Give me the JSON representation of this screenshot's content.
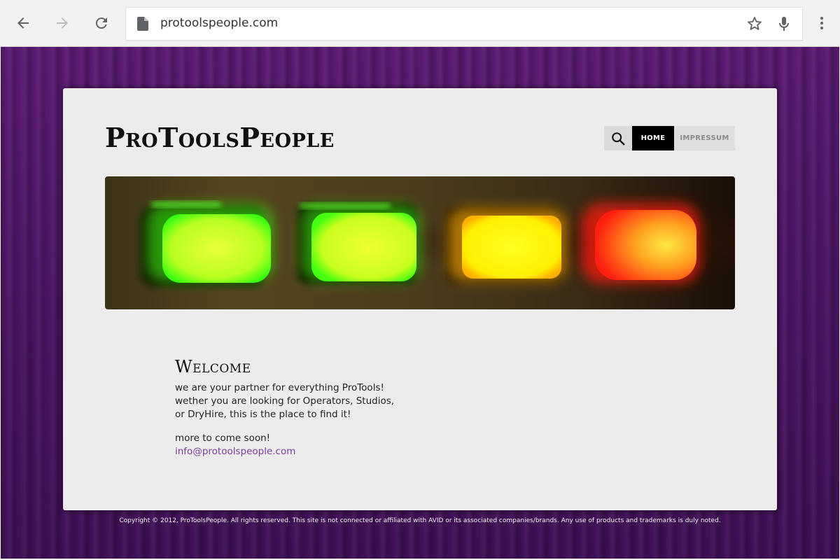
{
  "browser": {
    "url": "protoolspeople.com",
    "icons": [
      "back-arrow-icon",
      "forward-arrow-icon",
      "reload-icon",
      "page-icon",
      "star-icon",
      "mic-icon",
      "more-vert-icon"
    ]
  },
  "site": {
    "title": "ProToolsPeople",
    "nav": {
      "home": "HOME",
      "impressum": "IMPRESSUM"
    },
    "colors": {
      "background": "#4d1566",
      "card": "#ececec",
      "link": "#7d3b9a",
      "nav_active": "#000000"
    }
  },
  "content": {
    "heading": "Welcome",
    "para1": "we are your partner for everything ProTools! wether you are looking for Operators, Studios, or DryHire, this is the place to find it!",
    "para2": "more to come soon!",
    "email": "info@protoolspeople.com"
  },
  "footer": {
    "text": "Copyright © 2012, ProToolsPeople. All rights reserved. This site is not connected or affiliated with AVID or its associated companies/brands. Any use of products and trademarks is duly noted."
  }
}
